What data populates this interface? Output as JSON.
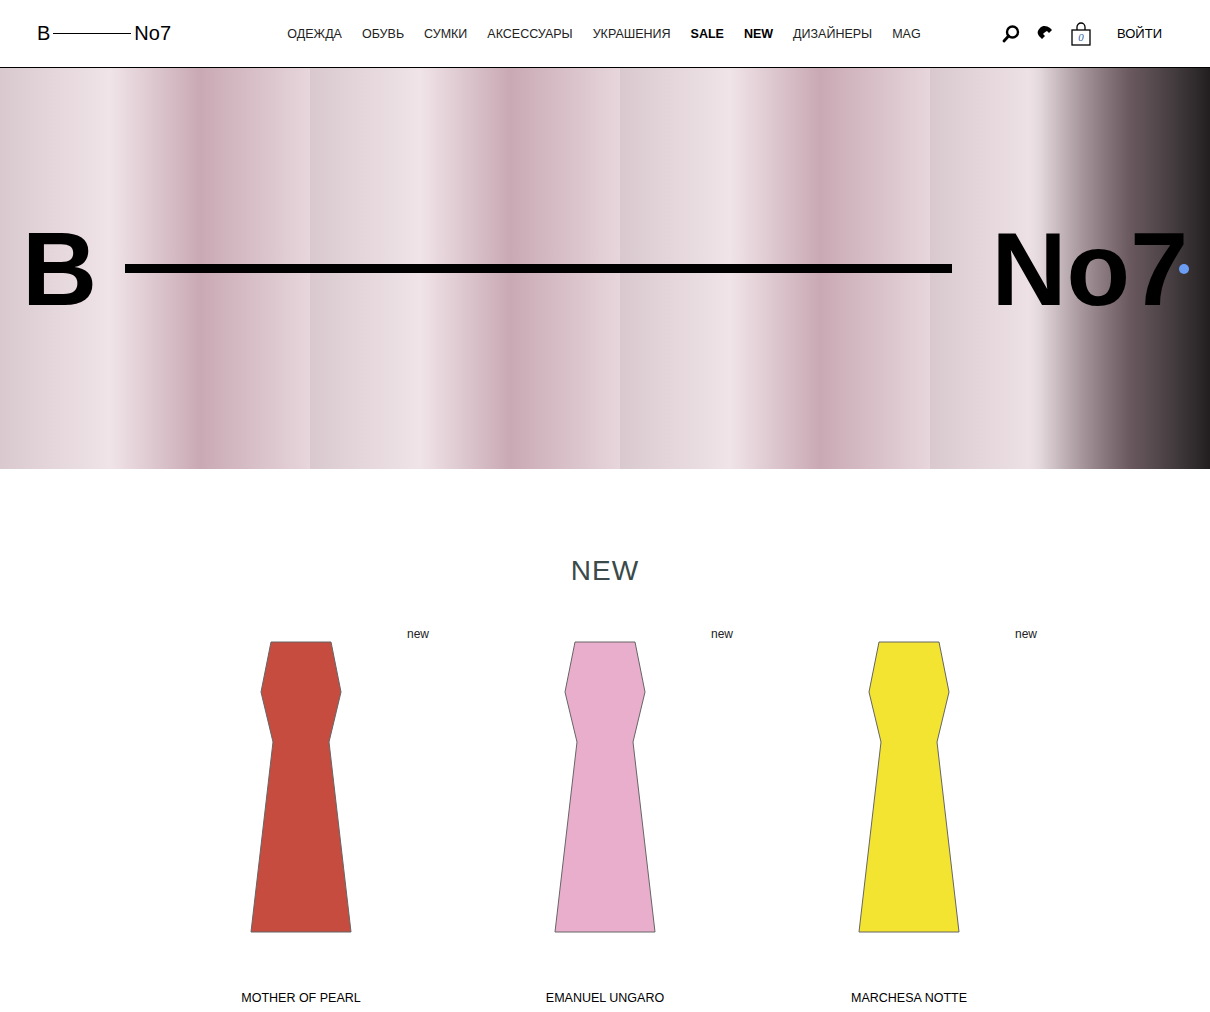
{
  "header": {
    "logo": {
      "left": "B",
      "right": "No7"
    },
    "nav": [
      {
        "label": "ОДЕЖДА",
        "highlighted": false
      },
      {
        "label": "ОБУВЬ",
        "highlighted": false
      },
      {
        "label": "СУМКИ",
        "highlighted": false
      },
      {
        "label": "АКСЕССУАРЫ",
        "highlighted": false
      },
      {
        "label": "УКРАШЕНИЯ",
        "highlighted": false
      },
      {
        "label": "SALE",
        "highlighted": true
      },
      {
        "label": "NEW",
        "highlighted": true
      },
      {
        "label": "ДИЗАЙНЕРЫ",
        "highlighted": false
      },
      {
        "label": "MAG",
        "highlighted": false
      }
    ],
    "cart": {
      "count": "0"
    },
    "login": "ВОЙТИ"
  },
  "hero": {
    "logo": {
      "left": "B",
      "right": "No7"
    }
  },
  "new_section": {
    "title": "NEW",
    "products": [
      {
        "brand": "MOTHER OF PEARL",
        "badge": "new",
        "color": "#c0392b"
      },
      {
        "brand": "EMANUEL UNGARO",
        "badge": "new",
        "color": "#e8a6c8"
      },
      {
        "brand": "MARCHESA NOTTE",
        "badge": "new",
        "color": "#f2e21b"
      }
    ]
  }
}
